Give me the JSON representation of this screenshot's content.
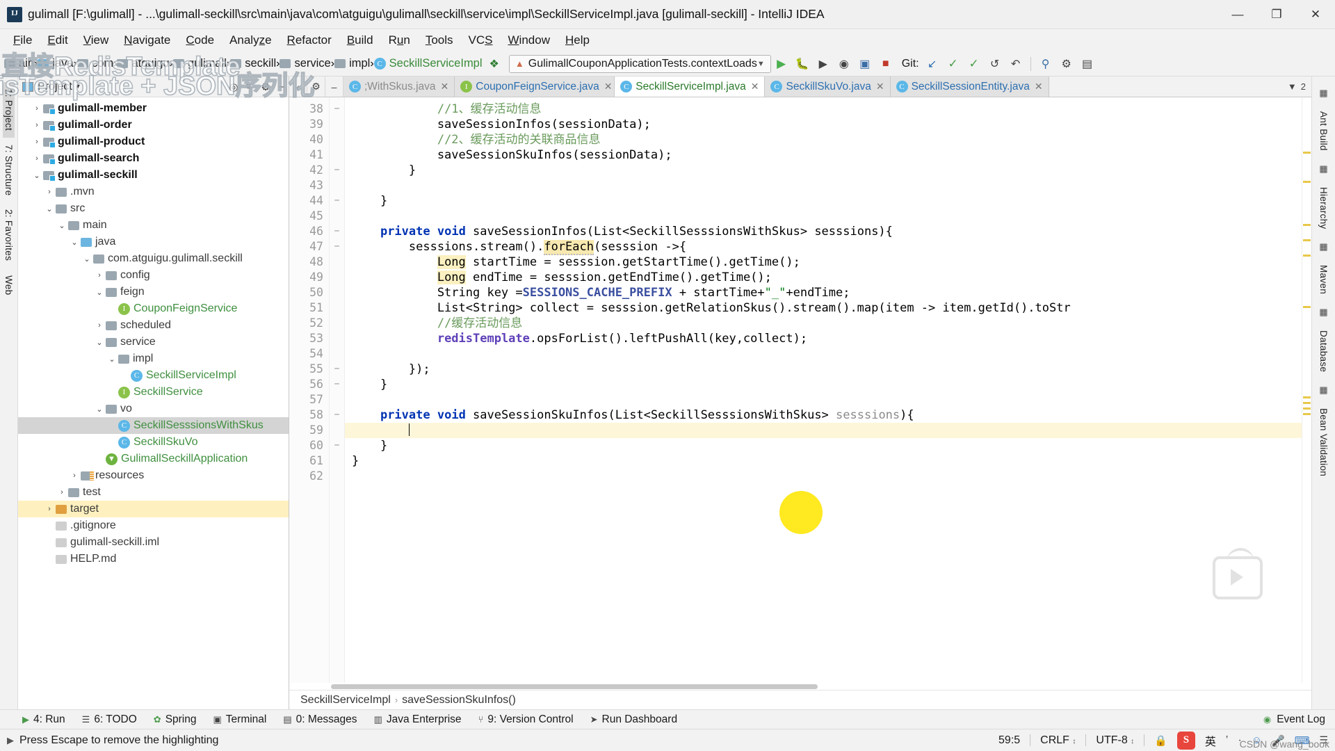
{
  "window": {
    "title": "gulimall [F:\\gulimall] - ...\\gulimall-seckill\\src\\main\\java\\com\\atguigu\\gulimall\\seckill\\service\\impl\\SeckillServiceImpl.java [gulimall-seckill] - IntelliJ IDEA",
    "minimize": "—",
    "maximize": "❐",
    "close": "✕",
    "app_icon": "intellij-idea-icon"
  },
  "watermark": {
    "line1": "直接RedisTemplate",
    "line2": "isTemplate + JSON序列化",
    "csdn": "CSDN @wang_book"
  },
  "menu": [
    {
      "label": "File",
      "accel": "F"
    },
    {
      "label": "Edit",
      "accel": "E"
    },
    {
      "label": "View",
      "accel": "V"
    },
    {
      "label": "Navigate",
      "accel": "N"
    },
    {
      "label": "Code",
      "accel": "C"
    },
    {
      "label": "Analyze",
      "accel": "z"
    },
    {
      "label": "Refactor",
      "accel": "R"
    },
    {
      "label": "Build",
      "accel": "B"
    },
    {
      "label": "Run",
      "accel": "u"
    },
    {
      "label": "Tools",
      "accel": "T"
    },
    {
      "label": "VCS",
      "accel": "S"
    },
    {
      "label": "Window",
      "accel": "W"
    },
    {
      "label": "Help",
      "accel": "H"
    }
  ],
  "navbar": {
    "crumbs": [
      {
        "label": "ain",
        "icon": "folder-icon"
      },
      {
        "label": "java",
        "icon": "folder-blue-icon"
      },
      {
        "label": "com",
        "icon": "folder-icon"
      },
      {
        "label": "atguigu",
        "icon": "folder-icon"
      },
      {
        "label": "gulimall",
        "icon": "folder-icon"
      },
      {
        "label": "seckill",
        "icon": "folder-icon"
      },
      {
        "label": "service",
        "icon": "folder-icon"
      },
      {
        "label": "impl",
        "icon": "folder-icon"
      },
      {
        "label": "SeckillServiceImpl",
        "icon": "class-icon"
      }
    ],
    "run_config": "GulimallCouponApplicationTests.contextLoads",
    "git_label": "Git:",
    "hammer_icon": "build-hammer-icon"
  },
  "tabs": [
    {
      "label": ";WithSkus.java",
      "icon": "class-icon",
      "active": false,
      "faded": true
    },
    {
      "label": "CouponFeignService.java",
      "icon": "interface-icon",
      "active": false
    },
    {
      "label": "SeckillServiceImpl.java",
      "icon": "class-icon",
      "active": true
    },
    {
      "label": "SeckillSkuVo.java",
      "icon": "class-icon",
      "active": false
    },
    {
      "label": "SeckillSessionEntity.java",
      "icon": "class-icon",
      "active": false
    }
  ],
  "tab_counter": "2",
  "project_panel": {
    "title": "Project",
    "caret": "▾",
    "locate_icon": "locate-target-icon",
    "collapse_icon": "collapse-all-icon",
    "tree": [
      {
        "depth": 1,
        "arrow": "›",
        "label": "gulimall-member",
        "style": "bold",
        "icon": "module-folder-icon"
      },
      {
        "depth": 1,
        "arrow": "›",
        "label": "gulimall-order",
        "style": "bold",
        "icon": "module-folder-icon"
      },
      {
        "depth": 1,
        "arrow": "›",
        "label": "gulimall-product",
        "style": "bold",
        "icon": "module-folder-icon"
      },
      {
        "depth": 1,
        "arrow": "›",
        "label": "gulimall-search",
        "style": "bold",
        "icon": "module-folder-icon"
      },
      {
        "depth": 1,
        "arrow": "⌄",
        "label": "gulimall-seckill",
        "style": "bold",
        "icon": "module-folder-icon"
      },
      {
        "depth": 2,
        "arrow": "›",
        "label": ".mvn",
        "style": "dim",
        "icon": "folder-icon"
      },
      {
        "depth": 2,
        "arrow": "⌄",
        "label": "src",
        "style": "dim",
        "icon": "folder-icon"
      },
      {
        "depth": 3,
        "arrow": "⌄",
        "label": "main",
        "style": "dim",
        "icon": "folder-icon"
      },
      {
        "depth": 4,
        "arrow": "⌄",
        "label": "java",
        "style": "dim",
        "icon": "folder-blue-icon"
      },
      {
        "depth": 5,
        "arrow": "⌄",
        "label": "com.atguigu.gulimall.seckill",
        "style": "dim",
        "icon": "package-icon"
      },
      {
        "depth": 6,
        "arrow": "›",
        "label": "config",
        "style": "dim",
        "icon": "package-icon"
      },
      {
        "depth": 6,
        "arrow": "⌄",
        "label": "feign",
        "style": "dim",
        "icon": "package-icon"
      },
      {
        "depth": 7,
        "arrow": "",
        "label": "CouponFeignService",
        "style": "cls",
        "icon": "interface-icon"
      },
      {
        "depth": 6,
        "arrow": "›",
        "label": "scheduled",
        "style": "dim",
        "icon": "package-icon"
      },
      {
        "depth": 6,
        "arrow": "⌄",
        "label": "service",
        "style": "dim",
        "icon": "package-icon"
      },
      {
        "depth": 7,
        "arrow": "⌄",
        "label": "impl",
        "style": "dim",
        "icon": "package-icon"
      },
      {
        "depth": 8,
        "arrow": "",
        "label": "SeckillServiceImpl",
        "style": "cls",
        "icon": "class-icon"
      },
      {
        "depth": 7,
        "arrow": "",
        "label": "SeckillService",
        "style": "cls",
        "icon": "interface-icon"
      },
      {
        "depth": 6,
        "arrow": "⌄",
        "label": "vo",
        "style": "dim",
        "icon": "package-icon"
      },
      {
        "depth": 7,
        "arrow": "",
        "label": "SeckillSesssionsWithSkus",
        "style": "cls",
        "icon": "class-icon",
        "selected": true
      },
      {
        "depth": 7,
        "arrow": "",
        "label": "SeckillSkuVo",
        "style": "cls",
        "icon": "class-icon"
      },
      {
        "depth": 6,
        "arrow": "",
        "label": "GulimallSeckillApplication",
        "style": "app",
        "icon": "spring-app-icon"
      },
      {
        "depth": 4,
        "arrow": "›",
        "label": "resources",
        "style": "dim",
        "icon": "resources-folder-icon"
      },
      {
        "depth": 3,
        "arrow": "›",
        "label": "test",
        "style": "dim",
        "icon": "folder-icon"
      },
      {
        "depth": 2,
        "arrow": "›",
        "label": "target",
        "style": "dim",
        "icon": "folder-orange-icon",
        "highlight": true
      },
      {
        "depth": 2,
        "arrow": "",
        "label": ".gitignore",
        "style": "dim",
        "icon": "file-icon"
      },
      {
        "depth": 2,
        "arrow": "",
        "label": "gulimall-seckill.iml",
        "style": "dim",
        "icon": "file-icon"
      },
      {
        "depth": 2,
        "arrow": "",
        "label": "HELP.md",
        "style": "dim",
        "icon": "file-icon"
      }
    ]
  },
  "left_rail": [
    {
      "label": "1: Project",
      "selected": true
    },
    {
      "label": "7: Structure",
      "selected": false
    },
    {
      "label": "2: Favorites",
      "selected": false
    },
    {
      "label": "Web",
      "selected": false
    }
  ],
  "right_rail": [
    {
      "label": "Ant Build"
    },
    {
      "label": "Hierarchy"
    },
    {
      "label": "Maven"
    },
    {
      "label": "Database"
    },
    {
      "label": "Bean Validation"
    }
  ],
  "code": {
    "first_line": 38,
    "lines": [
      {
        "n": 38,
        "fold": "−",
        "html": "            <c>//1、缓存活动信息</c>"
      },
      {
        "n": 39,
        "fold": "",
        "html": "            saveSessionInfos(sessionData);"
      },
      {
        "n": 40,
        "fold": "",
        "html": "            <c>//2、缓存活动的关联商品信息</c>"
      },
      {
        "n": 41,
        "fold": "",
        "html": "            saveSessionSkuInfos(sessionData);"
      },
      {
        "n": 42,
        "fold": "−",
        "html": "        }"
      },
      {
        "n": 43,
        "fold": "",
        "html": ""
      },
      {
        "n": 44,
        "fold": "−",
        "html": "    }"
      },
      {
        "n": 45,
        "fold": "",
        "html": ""
      },
      {
        "n": 46,
        "fold": "−",
        "ann": "@",
        "html": "    <k>private</k> <k>void</k> saveSessionInfos(List&lt;SeckillSesssionsWithSkus&gt; sesssions){"
      },
      {
        "n": 47,
        "fold": "−",
        "warn": "↑",
        "html": "        sesssions.stream().<hw>forEach</hw>(sesssion -&gt;{"
      },
      {
        "n": 48,
        "fold": "",
        "html": "            <hv>Long</hv> startTime = sesssion.getStartTime().getTime();"
      },
      {
        "n": 49,
        "fold": "",
        "html": "            <hv>Long</hv> endTime = sesssion.getEndTime().getTime();"
      },
      {
        "n": 50,
        "fold": "",
        "html": "            String key =<cn>SESSIONS_CACHE_PREFIX</cn> + startTime+<s>\"_\"</s>+endTime;"
      },
      {
        "n": 51,
        "fold": "",
        "warn": "↑",
        "html": "            List&lt;String&gt; collect = sesssion.getRelationSkus().stream().map(item -&gt; item.getId().toStr"
      },
      {
        "n": 52,
        "fold": "",
        "html": "            <c>//缓存活动信息</c>"
      },
      {
        "n": 53,
        "fold": "",
        "html": "            <f>redisTemplate</f>.opsForList().leftPushAll(key,collect);"
      },
      {
        "n": 54,
        "fold": "",
        "html": ""
      },
      {
        "n": 55,
        "fold": "−",
        "html": "        });"
      },
      {
        "n": 56,
        "fold": "−",
        "html": "    }"
      },
      {
        "n": 57,
        "fold": "",
        "html": ""
      },
      {
        "n": 58,
        "fold": "−",
        "html": "    <k>private</k> <k>void</k> saveSessionSkuInfos(List&lt;SeckillSesssionsWithSkus&gt; <p>sesssions</p>){"
      },
      {
        "n": 59,
        "fold": "",
        "caret": true,
        "highlight": true,
        "html": "        "
      },
      {
        "n": 60,
        "fold": "−",
        "html": "    }"
      },
      {
        "n": 61,
        "fold": "",
        "html": "}"
      },
      {
        "n": 62,
        "fold": "",
        "html": ""
      }
    ]
  },
  "editor_breadcrumb": [
    "SeckillServiceImpl",
    "saveSessionSkuInfos()"
  ],
  "bottom_toolwindows": [
    {
      "label": "4: Run",
      "icon": "run-icon"
    },
    {
      "label": "6: TODO",
      "icon": "todo-icon"
    },
    {
      "label": "Spring",
      "icon": "spring-icon"
    },
    {
      "label": "Terminal",
      "icon": "terminal-icon"
    },
    {
      "label": "0: Messages",
      "icon": "messages-icon"
    },
    {
      "label": "Java Enterprise",
      "icon": "java-ee-icon"
    },
    {
      "label": "9: Version Control",
      "icon": "version-control-icon"
    },
    {
      "label": "Run Dashboard",
      "icon": "run-dashboard-icon"
    }
  ],
  "event_log": {
    "label": "Event Log",
    "icon": "event-log-icon"
  },
  "statusbar": {
    "message": "Press Escape to remove the highlighting",
    "caret_position": "59:5",
    "line_separator": "CRLF",
    "encoding": "UTF-8",
    "lock_icon": "lock-icon",
    "ime_label": "英",
    "ime_icons": [
      "sogou-icon",
      "half-width-icon",
      "punctuation-icon",
      "emoji-icon",
      "mic-icon",
      "keyboard-icon",
      "menu-icon"
    ]
  },
  "colors": {
    "accent_green": "#3a8a3a",
    "keyword_blue": "#0033b3",
    "comment_green": "#6a9b5c",
    "highlight_yellow": "#ffe81a",
    "line_highlight": "#fdf6d8",
    "selection_gray": "#d4d4d4"
  }
}
